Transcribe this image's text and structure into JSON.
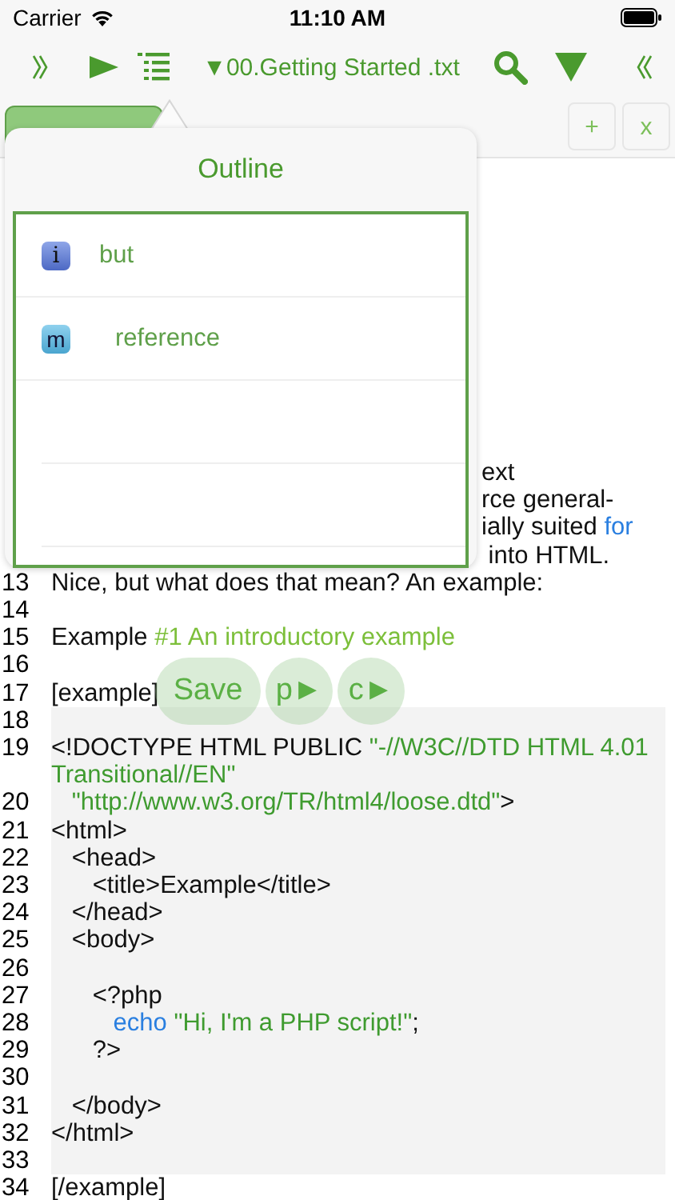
{
  "status_bar": {
    "carrier": "Carrier",
    "time": "11:10 AM"
  },
  "toolbar": {
    "title": "▼00.Getting Started .txt"
  },
  "tabs": [
    {
      "selected": true
    }
  ],
  "tab_actions": [
    "+",
    "x"
  ],
  "editor": {
    "sections": [
      {
        "kind": "text",
        "lines": [
          {
            "kind": "covered",
            "spans": [
              {
                "text": "ext",
                "kind": "plain"
              }
            ]
          },
          {
            "kind": "covered",
            "spans": [
              {
                "text": "rce general-",
                "kind": "plain"
              }
            ]
          },
          {
            "kind": "covered",
            "spans": [
              {
                "text": "ially suited ",
                "kind": "plain"
              },
              {
                "text": "for",
                "kind": "keyword"
              }
            ]
          },
          {
            "kind": "covered",
            "spans": [
              {
                "text": " into HTML.",
                "kind": "plain"
              }
            ]
          },
          {
            "kind": "line",
            "number": "13",
            "spans": [
              {
                "text": "Nice, but what does that mean? An example:",
                "kind": "plain"
              }
            ]
          },
          {
            "kind": "line",
            "number": "14"
          },
          {
            "kind": "line",
            "number": "15",
            "spans": [
              {
                "text": "Example ",
                "kind": "plain"
              },
              {
                "text": "#1 An introductory example",
                "kind": "heading"
              }
            ]
          },
          {
            "kind": "line",
            "number": "16"
          },
          {
            "kind": "line",
            "number": "17",
            "spans": [
              {
                "text": "[example]",
                "kind": "plain"
              }
            ]
          }
        ]
      },
      {
        "kind": "code",
        "lines": [
          {
            "kind": "line",
            "number": "18"
          },
          {
            "kind": "line",
            "number": "19",
            "spans": [
              {
                "text": "<!DOCTYPE HTML PUBLIC ",
                "kind": "plain"
              },
              {
                "text": "\"-//W3C//DTD HTML 4.01 Transitional//EN\"",
                "kind": "string"
              }
            ]
          },
          {
            "kind": "line",
            "number": "20",
            "spans": [
              {
                "text": "   \"http://www.w3.org/TR/html4/loose.dtd\"",
                "kind": "string"
              },
              {
                "text": ">",
                "kind": "plain"
              }
            ]
          },
          {
            "kind": "line",
            "number": "21",
            "spans": [
              {
                "text": "<html>",
                "kind": "plain"
              }
            ]
          },
          {
            "kind": "line",
            "number": "22",
            "spans": [
              {
                "text": "   <head>",
                "kind": "plain"
              }
            ]
          },
          {
            "kind": "line",
            "number": "23",
            "spans": [
              {
                "text": "      <title>Example</title>",
                "kind": "plain"
              }
            ]
          },
          {
            "kind": "line",
            "number": "24",
            "spans": [
              {
                "text": "   </head>",
                "kind": "plain"
              }
            ]
          },
          {
            "kind": "line",
            "number": "25",
            "spans": [
              {
                "text": "   <body>",
                "kind": "plain"
              }
            ]
          },
          {
            "kind": "line",
            "number": "26"
          },
          {
            "kind": "line",
            "number": "27",
            "spans": [
              {
                "text": "      <?php",
                "kind": "plain"
              }
            ]
          },
          {
            "kind": "line",
            "number": "28",
            "spans": [
              {
                "text": "         echo",
                "kind": "keyword"
              },
              {
                "text": " \"Hi, I'm a PHP script!\"",
                "kind": "string"
              },
              {
                "text": ";",
                "kind": "plain"
              }
            ]
          },
          {
            "kind": "line",
            "number": "29",
            "spans": [
              {
                "text": "      ?>",
                "kind": "plain"
              }
            ]
          },
          {
            "kind": "line",
            "number": "30"
          },
          {
            "kind": "line",
            "number": "31",
            "spans": [
              {
                "text": "   </body>",
                "kind": "plain"
              }
            ]
          },
          {
            "kind": "line",
            "number": "32",
            "spans": [
              {
                "text": "</html>",
                "kind": "plain"
              }
            ]
          },
          {
            "kind": "line",
            "number": "33"
          }
        ]
      },
      {
        "kind": "text",
        "lines": [
          {
            "kind": "line",
            "number": "34",
            "spans": [
              {
                "text": "[/example]",
                "kind": "plain"
              }
            ]
          }
        ]
      }
    ]
  },
  "floating_buttons": [
    "Save",
    "p►",
    "c►"
  ],
  "outline": {
    "title": "Outline",
    "items": [
      {
        "label": "but",
        "badge": "i",
        "kind": "info",
        "children": [
          {
            "label": "reference",
            "badge": "m",
            "kind": "method"
          }
        ]
      }
    ]
  }
}
